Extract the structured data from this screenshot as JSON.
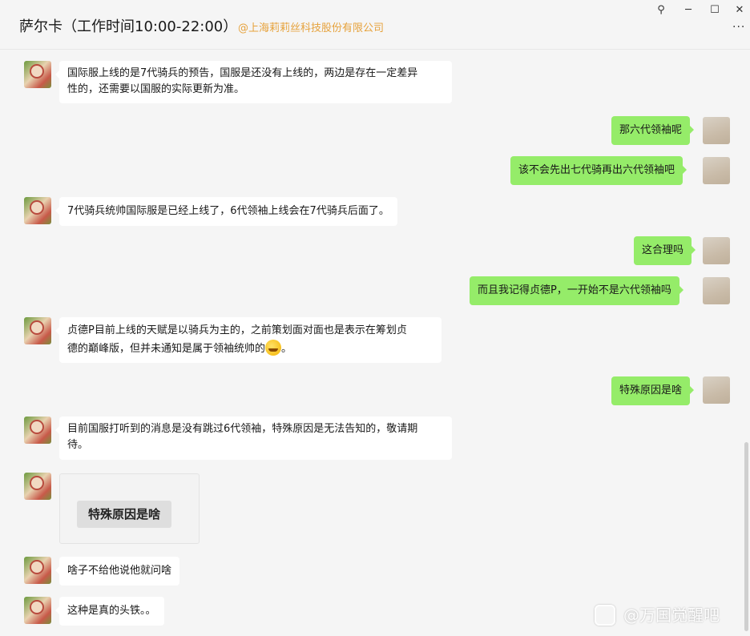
{
  "header": {
    "title": "萨尔卡（工作时间10:00-22:00）",
    "corp": "@上海莉莉丝科技股份有限公司",
    "pin": "⚲",
    "minimize": "─",
    "maximize": "☐",
    "close": "✕",
    "more": "···"
  },
  "messages": [
    {
      "side": "left",
      "lines": [
        "国际服上线的是7代骑兵的预告，国服是还没有上线的，两边是存在一定差异",
        "性的，还需要以国服的实际更新为准。"
      ]
    },
    {
      "side": "right",
      "text": "那六代领袖呢"
    },
    {
      "side": "right",
      "text": "该不会先出七代骑再出六代领袖吧"
    },
    {
      "side": "left",
      "text": "7代骑兵统帅国际服是已经上线了，6代领袖上线会在7代骑兵后面了。"
    },
    {
      "side": "right",
      "text": "这合理吗"
    },
    {
      "side": "right",
      "text": "而且我记得贞德P，一开始不是六代领袖吗"
    },
    {
      "side": "left",
      "line1": "贞德P目前上线的天赋是以骑兵为主的，之前策划面对面也是表示在筹划贞",
      "line2_before": "德的巅峰版，但并未通知是属于领袖统帅的",
      "emoji": "laughing-emoji",
      "line2_after": "。"
    },
    {
      "side": "right",
      "text": "特殊原因是啥"
    },
    {
      "side": "left",
      "lines": [
        "目前国服打听到的消息是没有跳过6代领袖，特殊原因是无法告知的，敬请期",
        "待。"
      ]
    },
    {
      "side": "left",
      "image_text": "特殊原因是啥"
    },
    {
      "side": "left",
      "text": "啥子不给他说他就问啥"
    },
    {
      "side": "left",
      "text": "这种是真的头铁。。"
    }
  ],
  "watermark": {
    "text": "@万国觉醒吧"
  },
  "colors": {
    "self_bubble": "#95ec69",
    "other_bubble": "#ffffff",
    "corp": "#e6a23c",
    "background": "#f5f5f5"
  }
}
